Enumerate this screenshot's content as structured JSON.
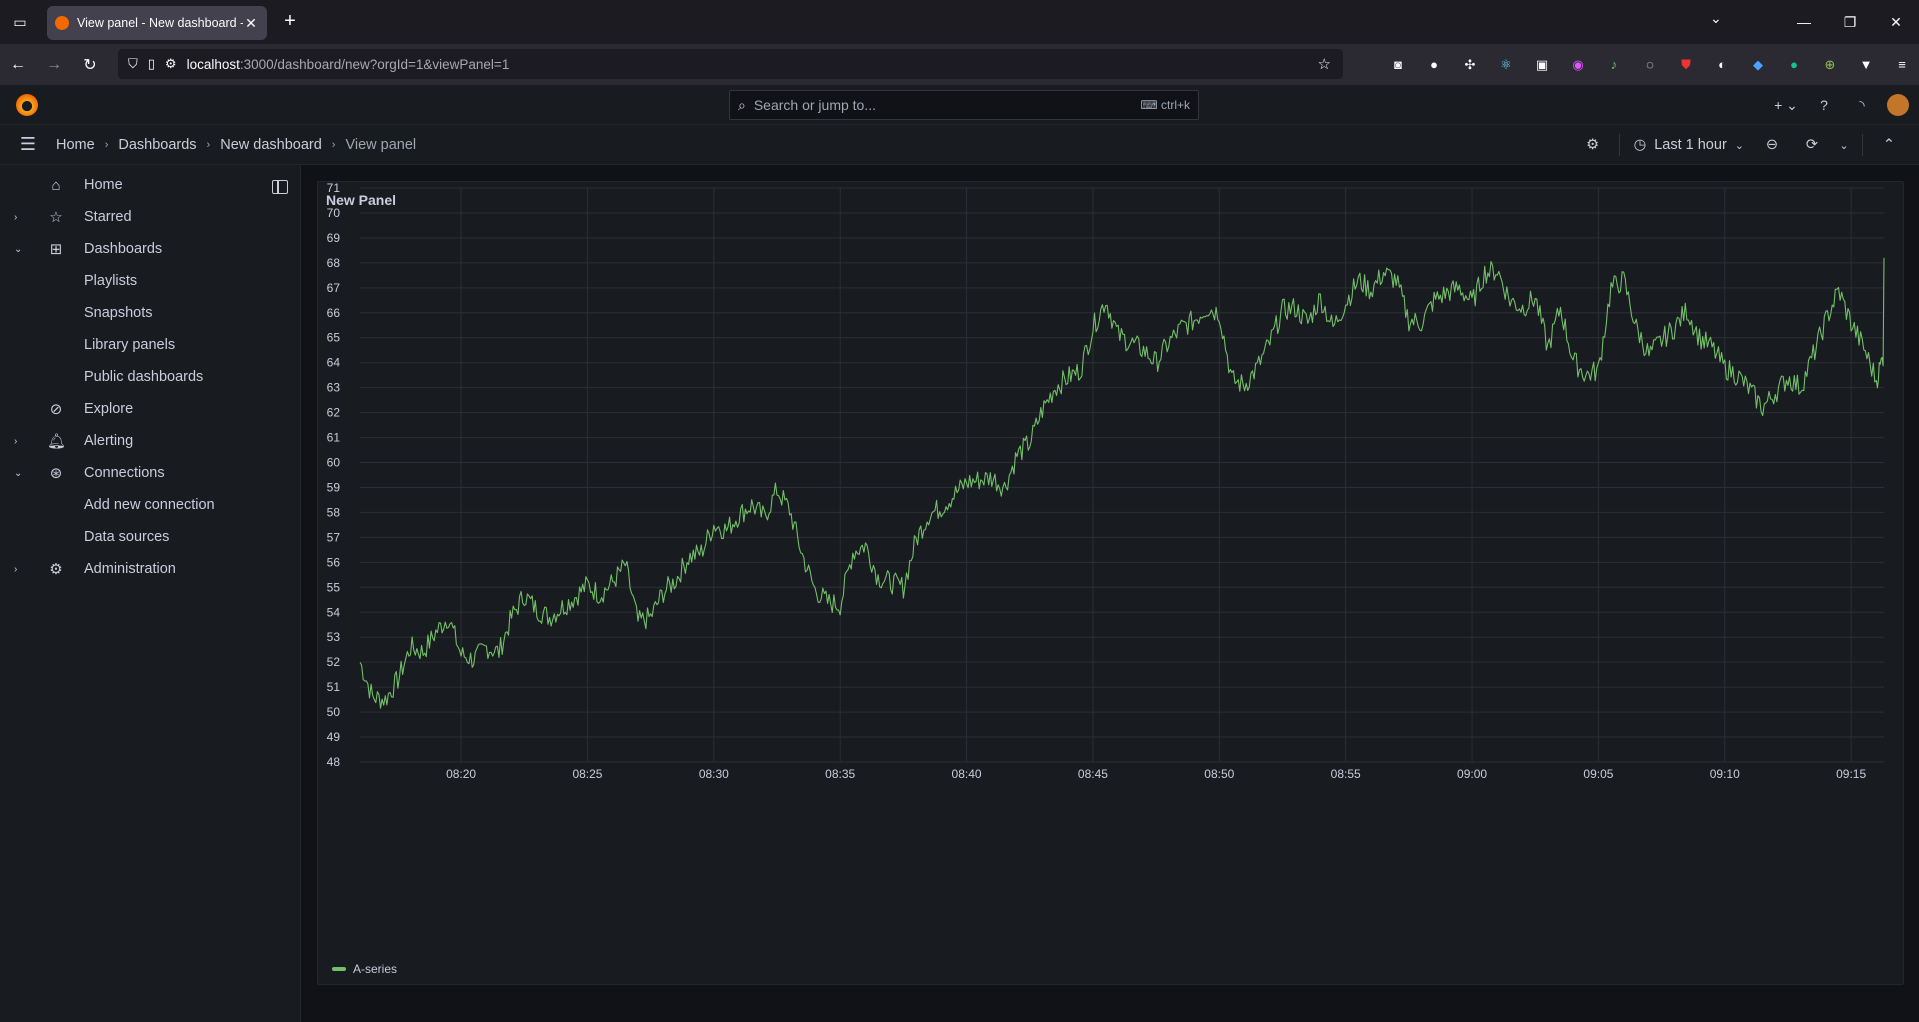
{
  "browser": {
    "tab_title": "View panel - New dashboard - ",
    "url_host": "localhost",
    "url_path": ":3000/dashboard/new?orgId=1&viewPanel=1"
  },
  "topbar": {
    "search_placeholder": "Search or jump to...",
    "search_shortcut": "ctrl+k"
  },
  "breadcrumb": [
    {
      "label": "Home"
    },
    {
      "label": "Dashboards"
    },
    {
      "label": "New dashboard"
    },
    {
      "label": "View panel"
    }
  ],
  "toolbar": {
    "time_range": "Last 1 hour"
  },
  "sidebar": {
    "items": [
      {
        "label": "Home",
        "icon": "home-icon",
        "chevron": ""
      },
      {
        "label": "Starred",
        "icon": "star-icon",
        "chevron": "›"
      },
      {
        "label": "Dashboards",
        "icon": "dashboards-icon",
        "chevron": "⌄"
      },
      {
        "label": "Playlists",
        "sub": true
      },
      {
        "label": "Snapshots",
        "sub": true
      },
      {
        "label": "Library panels",
        "sub": true
      },
      {
        "label": "Public dashboards",
        "sub": true
      },
      {
        "label": "Explore",
        "icon": "compass-icon",
        "chevron": ""
      },
      {
        "label": "Alerting",
        "icon": "bell-icon",
        "chevron": "›"
      },
      {
        "label": "Connections",
        "icon": "connections-icon",
        "chevron": "⌄"
      },
      {
        "label": "Add new connection",
        "sub": true
      },
      {
        "label": "Data sources",
        "sub": true
      },
      {
        "label": "Administration",
        "icon": "gear-icon",
        "chevron": "›"
      }
    ]
  },
  "panel": {
    "title": "New Panel"
  },
  "chart_data": {
    "type": "line",
    "title": "New Panel",
    "ylim": [
      48,
      71
    ],
    "y_ticks": [
      71,
      70,
      69,
      68,
      67,
      66,
      65,
      64,
      63,
      62,
      61,
      60,
      59,
      58,
      57,
      56,
      55,
      54,
      53,
      52,
      51,
      50,
      49,
      48
    ],
    "x_ticks": [
      "08:20",
      "08:25",
      "08:30",
      "08:35",
      "08:40",
      "08:45",
      "08:50",
      "08:55",
      "09:00",
      "09:05",
      "09:10",
      "09:15"
    ],
    "grid": true,
    "legend": "bottom-left",
    "series": [
      {
        "name": "A-series",
        "color": "#73bf69",
        "x_minutes_after_0816": [
          0,
          0.5,
          1,
          1.5,
          2,
          2.5,
          3,
          3.5,
          4,
          4.5,
          5,
          5.5,
          6,
          6.5,
          7,
          7.5,
          8,
          8.5,
          9,
          9.5,
          10,
          10.5,
          11,
          11.5,
          12,
          12.5,
          13,
          13.5,
          14,
          14.5,
          15,
          15.5,
          16,
          16.5,
          17,
          17.5,
          18,
          18.5,
          19,
          19.5,
          20,
          20.5,
          21,
          21.5,
          22,
          22.5,
          23,
          23.5,
          24,
          24.5,
          25,
          25.5,
          26,
          26.5,
          27,
          27.5,
          28,
          28.5,
          29,
          29.5,
          30,
          30.5,
          31,
          31.5,
          32,
          32.5,
          33,
          33.5,
          34,
          34.5,
          35,
          35.5,
          36,
          36.5,
          37,
          37.5,
          38,
          38.5,
          39,
          39.5,
          40,
          40.5,
          41,
          41.5,
          42,
          42.5,
          43,
          43.5,
          44,
          44.5,
          45,
          45.5,
          46,
          46.5,
          47,
          47.5,
          48,
          48.5,
          49,
          49.5,
          50,
          50.5,
          51,
          51.5,
          52,
          52.5,
          53,
          53.5,
          54,
          54.5,
          55,
          55.5,
          56,
          56.5,
          57,
          57.5,
          58,
          58.5,
          59,
          59.5,
          60,
          60.3
        ],
        "values": [
          52,
          50.6,
          50.5,
          51.3,
          52.6,
          52.4,
          53.2,
          53.8,
          52.3,
          52.1,
          52.6,
          52.4,
          53.8,
          54.7,
          54.1,
          53.8,
          54.2,
          54.6,
          55.1,
          54.7,
          55.2,
          55.9,
          53.6,
          53.8,
          54.8,
          55.3,
          56.2,
          56.4,
          57.5,
          57.3,
          57.9,
          58.3,
          57.8,
          58.9,
          58.1,
          56.3,
          54.9,
          54.4,
          54.3,
          56.4,
          56.7,
          55.4,
          55.2,
          55.0,
          56.9,
          57.9,
          58.2,
          58.7,
          59.2,
          59.3,
          59.4,
          59.0,
          60.3,
          60.8,
          62.1,
          63.0,
          63.4,
          63.7,
          65.4,
          66.5,
          65.1,
          64.8,
          64.5,
          64.0,
          64.8,
          65.4,
          65.7,
          66.2,
          66.0,
          63.3,
          63.1,
          63.8,
          64.8,
          66.1,
          66.2,
          65.6,
          66.6,
          65.4,
          66.4,
          67.3,
          66.9,
          67.6,
          67.3,
          65.7,
          65.6,
          66.5,
          66.8,
          67.0,
          66.4,
          67.6,
          67.7,
          66.5,
          66.2,
          66.6,
          64.6,
          66.2,
          64.1,
          63.5,
          63.7,
          67.0,
          67.3,
          65.4,
          64.3,
          64.9,
          65.4,
          66.1,
          65.0,
          64.6,
          63.8,
          63.5,
          62.9,
          62.2,
          62.8,
          63.4,
          63.0,
          64.3,
          65.7,
          66.9,
          65.6,
          64.6,
          63.3,
          64.4,
          65.7,
          66.4,
          65.5,
          66.7,
          67.3,
          66.5,
          65.9,
          68.2
        ]
      }
    ]
  }
}
